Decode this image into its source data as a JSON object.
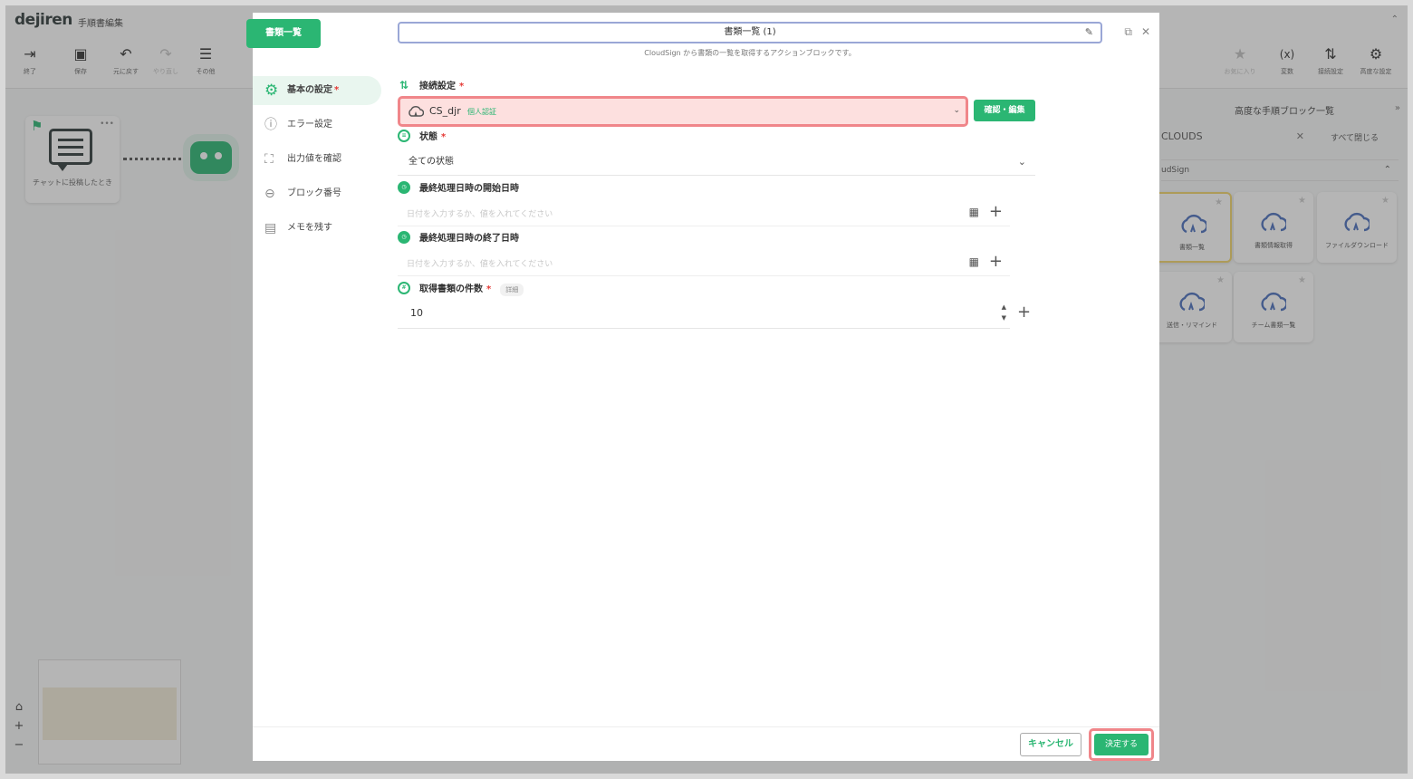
{
  "app": {
    "logo": "dejiren",
    "page_title": "手順書編集",
    "toolbar": [
      {
        "icon": "exit-icon",
        "label": "終了"
      },
      {
        "icon": "save-icon",
        "label": "保存"
      },
      {
        "icon": "undo-icon",
        "label": "元に戻す"
      },
      {
        "icon": "redo-icon",
        "label": "やり直し"
      },
      {
        "icon": "menu-icon",
        "label": "その他"
      }
    ],
    "toolbar_right": [
      {
        "icon": "star-icon",
        "label": "お気に入り"
      },
      {
        "icon": "variable-icon",
        "label": "変数"
      },
      {
        "icon": "connection-icon",
        "label": "接続設定"
      },
      {
        "icon": "advanced-icon",
        "label": "高度な設定"
      }
    ],
    "trigger_node_label": "チャットに投稿したとき",
    "right_panel": {
      "title": "高度な手順ブロック一覧",
      "search_value": "CLOUDS",
      "close_all": "すべて閉じる",
      "category": "CloudSign",
      "category_visible": "udSign",
      "cards": [
        {
          "name": "書類一覧"
        },
        {
          "name": "書類情報取得"
        },
        {
          "name": "ファイルダウンロード"
        },
        {
          "name": "送信・リマインド"
        },
        {
          "name": "チーム書類一覧"
        }
      ]
    }
  },
  "modal": {
    "tab_label": "書類一覧",
    "title_value": "書類一覧 (1)",
    "subtitle": "CloudSign から書類の一覧を取得するアクションブロックです。",
    "nav": [
      {
        "label": "基本の設定",
        "required": "*",
        "icon": "gear-icon"
      },
      {
        "label": "エラー設定",
        "required": "",
        "icon": "alert-icon"
      },
      {
        "label": "出力値を確認",
        "required": "",
        "icon": "output-icon"
      },
      {
        "label": "ブロック番号",
        "required": "",
        "icon": "number-icon"
      },
      {
        "label": "メモを残す",
        "required": "",
        "icon": "memo-icon"
      }
    ],
    "fields": {
      "connection": {
        "label": "接続設定",
        "required": "*",
        "value": "CS_djr",
        "badge": "個人認証",
        "button": "確認・編集"
      },
      "status": {
        "label": "状態",
        "required": "*",
        "value": "全ての状態"
      },
      "start_date": {
        "label": "最終処理日時の開始日時",
        "placeholder": "日付を入力するか、値を入れてください"
      },
      "end_date": {
        "label": "最終処理日時の終了日時",
        "placeholder": "日付を入力するか、値を入れてください"
      },
      "count": {
        "label": "取得書類の件数",
        "required": "*",
        "detail": "詳細",
        "value": "10"
      }
    },
    "footer": {
      "cancel": "キャンセル",
      "ok": "決定する"
    }
  },
  "colors": {
    "accent": "#2bb673",
    "highlight_border": "#f0868a",
    "highlight_fill": "#fde0df",
    "required": "#e53935"
  }
}
